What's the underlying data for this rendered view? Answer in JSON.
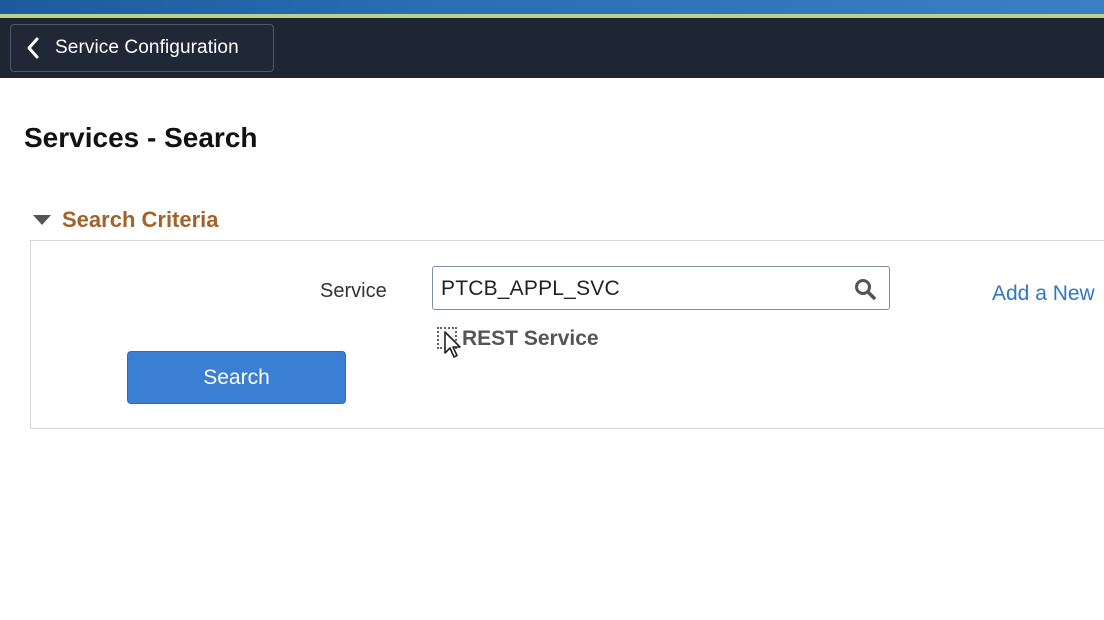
{
  "header": {
    "back_button_label": "Service Configuration"
  },
  "page": {
    "title": "Services - Search"
  },
  "search_criteria": {
    "section_label": "Search Criteria",
    "service_label": "Service",
    "service_value": "PTCB_APPL_SVC",
    "rest_service_label": "REST Service",
    "rest_service_checked": false,
    "add_new_label": "Add a New",
    "search_button_label": "Search"
  },
  "icons": {
    "back": "chevron-left-icon",
    "collapse": "triangle-down-icon",
    "lookup": "search-icon",
    "pointer": "mouse-cursor-icon"
  },
  "colors": {
    "header_bg": "#1e2533",
    "accent_link": "#2f76c8",
    "section_label": "#a3622a",
    "primary_button": "#3b7fd4"
  }
}
